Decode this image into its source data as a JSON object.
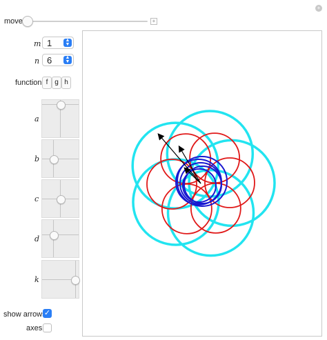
{
  "controls": {
    "move": {
      "label": "move",
      "value_fraction": 0.0
    },
    "m": {
      "label": "m",
      "value": "1"
    },
    "n": {
      "label": "n",
      "value": "6"
    },
    "function": {
      "label": "function",
      "options": [
        "f",
        "g",
        "h"
      ]
    },
    "pads": [
      {
        "label": "a"
      },
      {
        "label": "b"
      },
      {
        "label": "c"
      },
      {
        "label": "d"
      },
      {
        "label": "k"
      }
    ],
    "show_arrows": {
      "label": "show arrows",
      "checked": true
    },
    "axes": {
      "label": "axes",
      "checked": false
    }
  },
  "colors": {
    "cyan": "#22e4f0",
    "red": "#e01818",
    "blue": "#1818d0",
    "arrow": "#000000",
    "accent": "#2a7ef5"
  },
  "icons": {
    "reset": "plus-circle-icon",
    "spinner": "up-down-arrows-icon",
    "check": "checkmark-icon"
  }
}
